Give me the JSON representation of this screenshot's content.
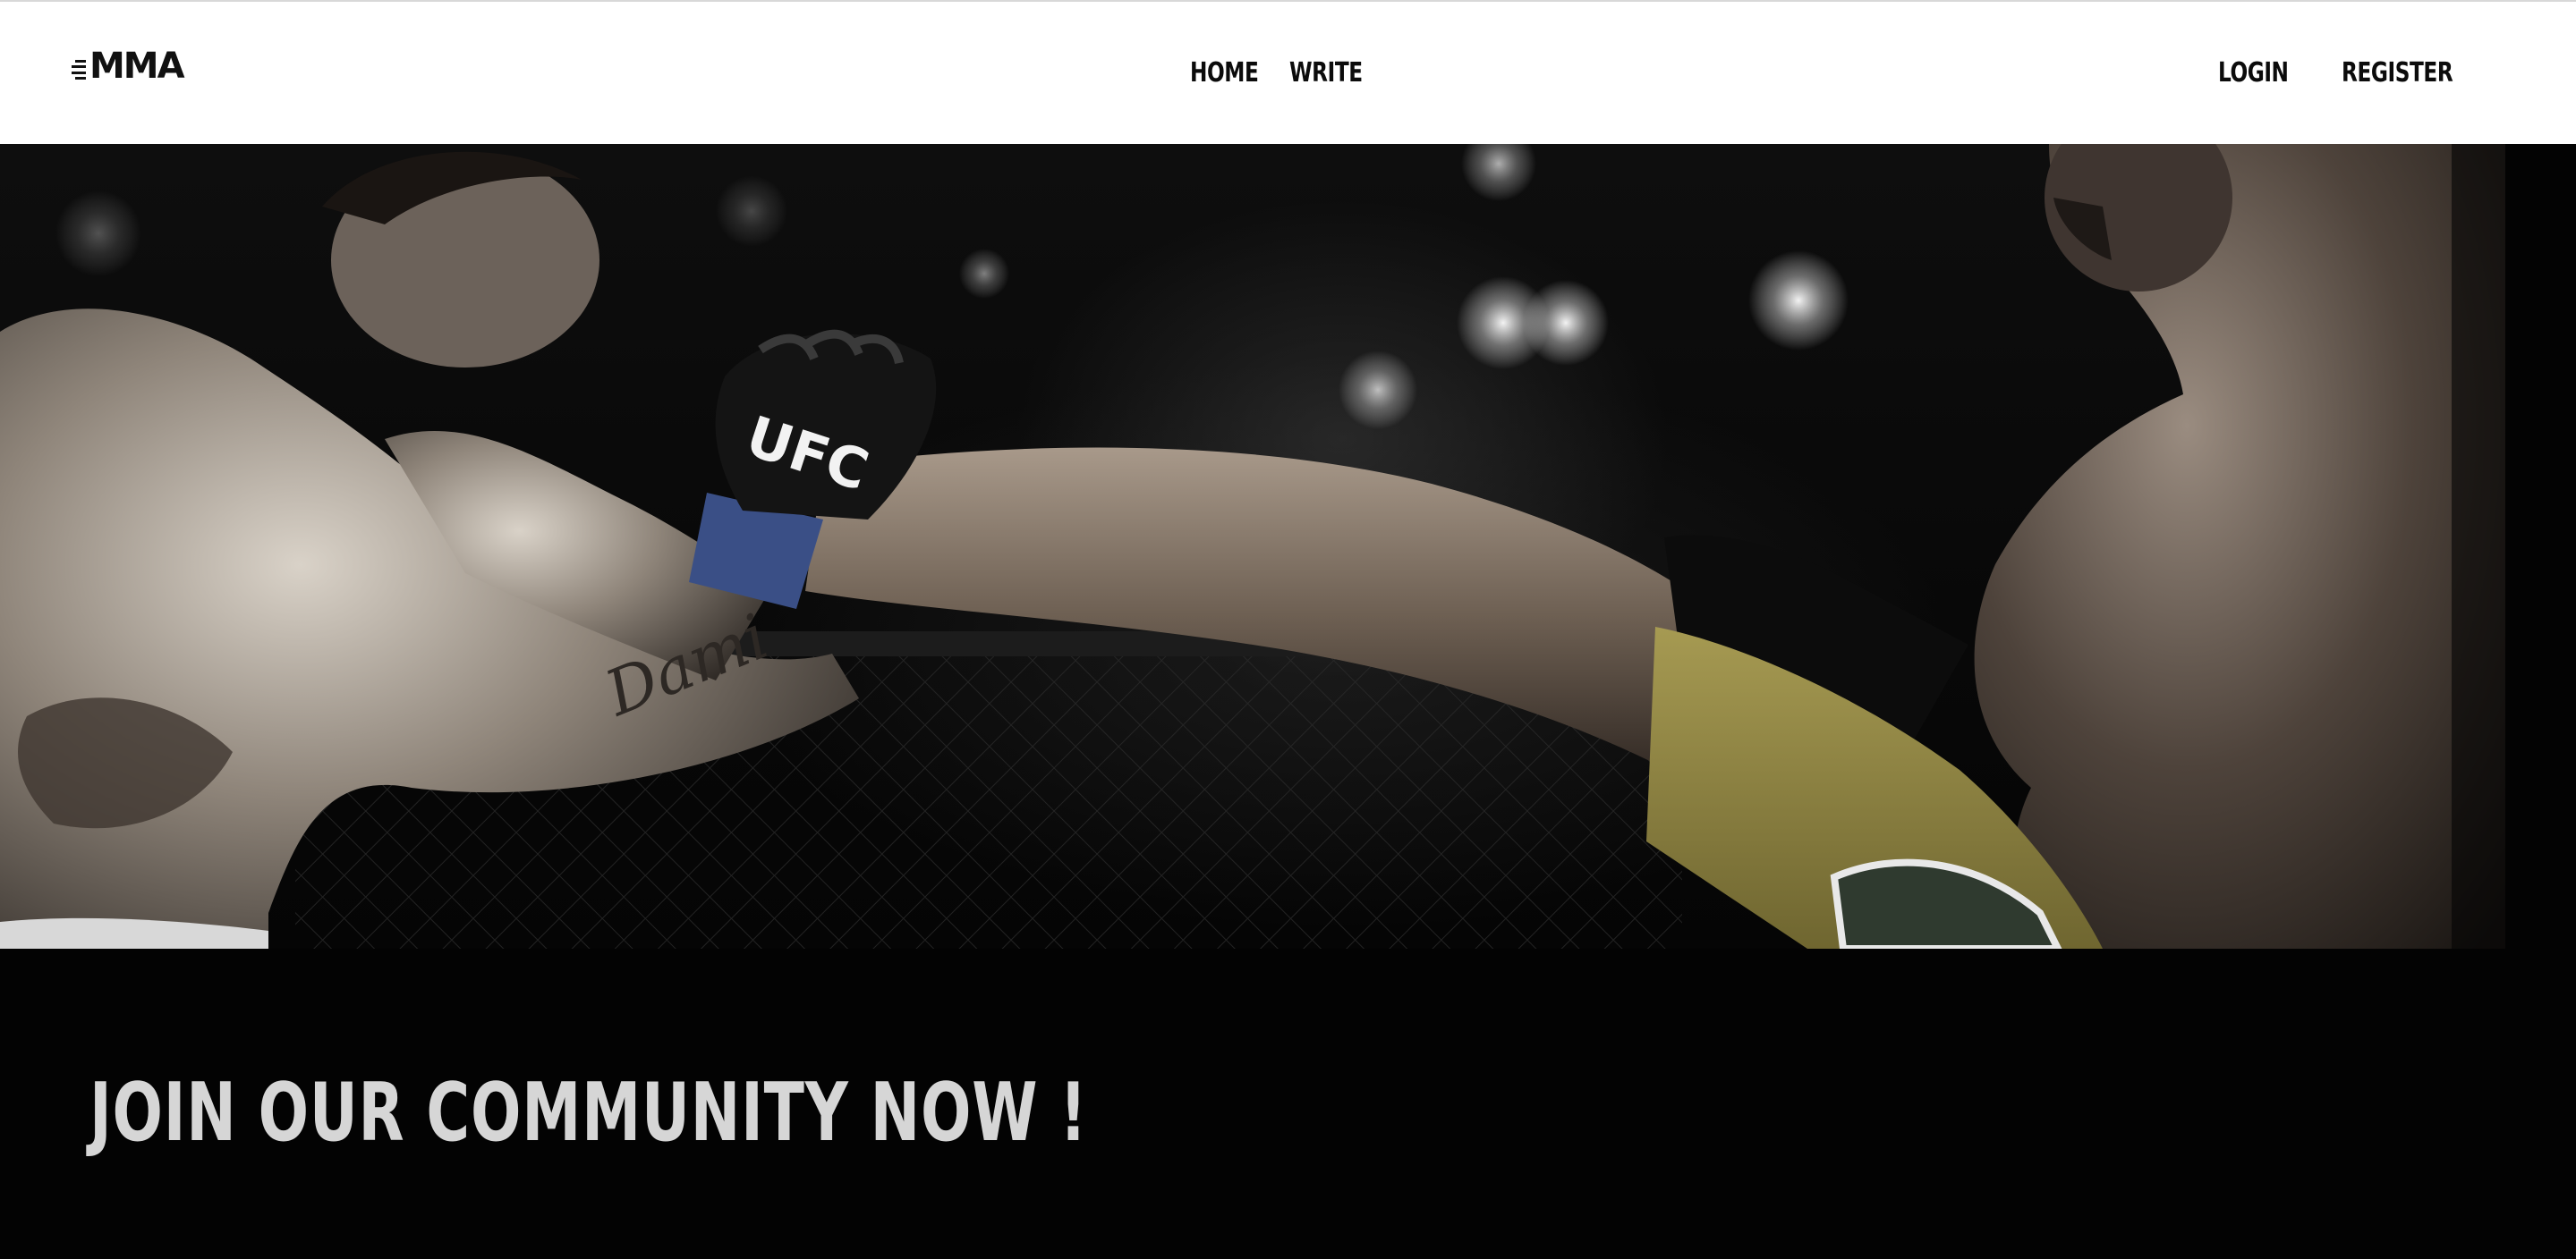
{
  "header": {
    "logo_text": "MMA",
    "nav_center": [
      {
        "label": "HOME"
      },
      {
        "label": "WRITE"
      }
    ],
    "nav_right": [
      {
        "label": "LOGIN"
      },
      {
        "label": "REGISTER"
      }
    ]
  },
  "hero": {
    "image_subject": "mma-fighters-high-kick-photo",
    "glove_brand": "UFC",
    "accent_colors": {
      "glove_wrap": "#3a4f86",
      "shorts": "#8f8440"
    }
  },
  "cta": {
    "headline": "JOIN OUR COMMUNITY NOW !"
  }
}
